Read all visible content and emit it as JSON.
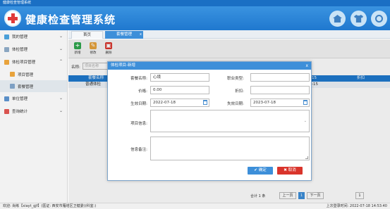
{
  "window": {
    "title": "健康检查管理系统"
  },
  "header": {
    "app_title": "健康检查管理系统",
    "buttons": [
      "home-icon",
      "shirt-icon",
      "power-icon"
    ],
    "colors": {
      "bar": "#1f78cf",
      "logo_cross": "#e03a3a"
    }
  },
  "sidebar": {
    "items": [
      {
        "label": "我的管理",
        "icon": "home-icon",
        "color": "#4a9fd8",
        "chevron": "⌄"
      },
      {
        "label": "体检管理",
        "icon": "doc-icon",
        "color": "#8aa6c1",
        "chevron": "⌄"
      },
      {
        "label": "体检项目管理",
        "icon": "pencil-icon",
        "color": "#e8a33c",
        "chevron": "⌃"
      },
      {
        "label": "项目管理",
        "icon": "pencil-icon",
        "color": "#e8a33c"
      },
      {
        "label": "套餐管理",
        "icon": "list-icon",
        "color": "#7da0c4",
        "active": true
      },
      {
        "label": "单位管理",
        "icon": "building-icon",
        "color": "#5a8fc7",
        "chevron": "⌄"
      },
      {
        "label": "查询统计",
        "icon": "chart-icon",
        "color": "#d9534f",
        "chevron": "⌄"
      }
    ]
  },
  "tabs": [
    {
      "label": "首页"
    },
    {
      "label": "套餐管理",
      "close": "x"
    }
  ],
  "toolbar": [
    {
      "label": "新增",
      "glyph": "+",
      "color": "#2fa84f"
    },
    {
      "label": "修改",
      "glyph": "✎",
      "color": "#e8a33c"
    },
    {
      "label": "删除",
      "glyph": "▣",
      "color": "#d9342b"
    }
  ],
  "search": {
    "label": "名称:",
    "placeholder": "项目名称"
  },
  "grid": {
    "columns": [
      "套餐名称",
      "15",
      "折扣"
    ],
    "rows": [
      {
        "name": "普通体检",
        "col2": "-15"
      }
    ]
  },
  "pager": {
    "count": "合计 1 条",
    "prev": "上一页",
    "current": "1",
    "next": "下一页",
    "goto": "1"
  },
  "dialog": {
    "title": "体检项目-新增",
    "close": "x",
    "fields": {
      "name_label": "套餐名称:",
      "name_value": "心境",
      "type_label": "职业类型:",
      "type_value": "",
      "price_label": "价格:",
      "price_value": "0.00",
      "discount_label": "折扣:",
      "discount_value": "",
      "start_label": "生效日期:",
      "start_value": "2022-07-18",
      "end_label": "失效日期:",
      "end_value": "2023-07-18",
      "items_label": "项目信息:",
      "remark_label": "信息备注:"
    },
    "ok": "确定",
    "cancel": "取消",
    "ok_color": "#3d8fd9",
    "cancel_color": "#d9342b"
  },
  "status": {
    "left": "欢迎: 尚练【xiayt_gjf】(医证: 西安市雁塔区卫健委)(科室:)",
    "right": "上次登录时间: 2022-07-18 14:53:40"
  }
}
